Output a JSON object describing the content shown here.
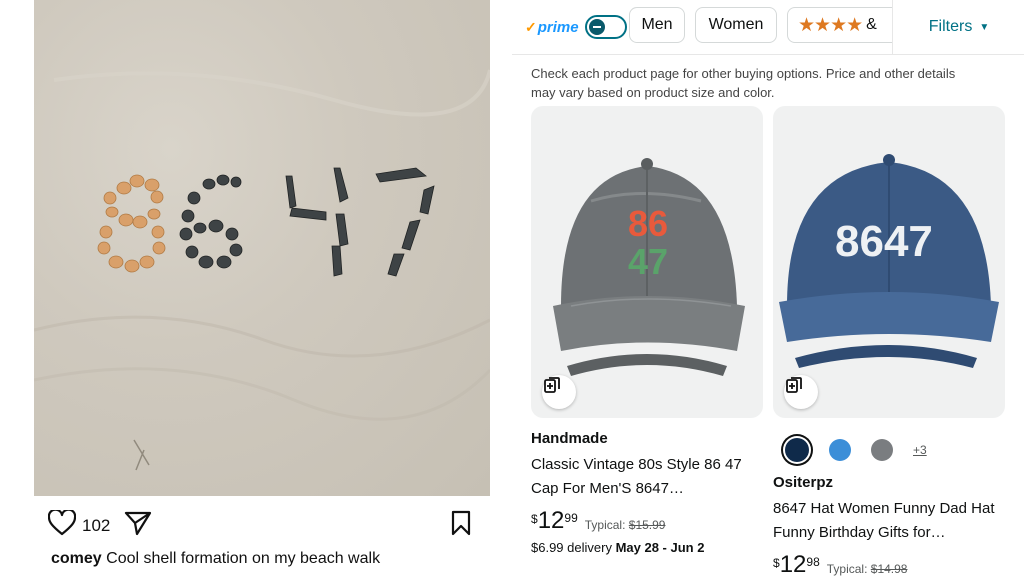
{
  "post": {
    "likes_count": "102",
    "username": "comey",
    "caption": "Cool shell formation on my beach walk",
    "icons": [
      "heart-icon",
      "share-icon",
      "bookmark-icon"
    ]
  },
  "shop": {
    "filters": {
      "prime_check": "✓",
      "prime_label": "prime",
      "chips": [
        "Men",
        "Women"
      ],
      "rating_stars": "★★★★",
      "rating_suffix": "&",
      "filters_label": "Filters"
    },
    "disclaimer": "Check each product page for other buying options. Price and other details may vary based on product size and color.",
    "products": [
      {
        "brand": "Handmade",
        "title": "Classic Vintage 80s Style 86 47 Cap For Men'S 8647…",
        "price_symbol": "$",
        "price_whole": "12",
        "price_cents": "99",
        "typical_label": "Typical:",
        "typical_price": "$15.99",
        "delivery_price": "$6.99 delivery",
        "delivery_dates": "May 28 - Jun 2",
        "hat_text": [
          "86",
          "47"
        ],
        "hat_text_colors": [
          "#e85a3c",
          "#e8b340",
          "#5aa36a",
          "#e89a3c"
        ],
        "hat_color": "#6d7174"
      },
      {
        "brand": "Ositerpz",
        "title": "8647 Hat Women Funny Dad Hat Funny Birthday Gifts for…",
        "price_symbol": "$",
        "price_whole": "12",
        "price_cents": "98",
        "typical_label": "Typical:",
        "typical_price": "$14.98",
        "hat_text": "8647",
        "hat_color": "#3b5a85",
        "swatches": [
          "#0f2a4a",
          "#3b8ed8",
          "#7a7d80"
        ],
        "more_colors": "+3"
      }
    ]
  },
  "colors": {
    "accent_link": "#007185",
    "star": "#de7921",
    "prime_blue": "#1a98ff"
  }
}
